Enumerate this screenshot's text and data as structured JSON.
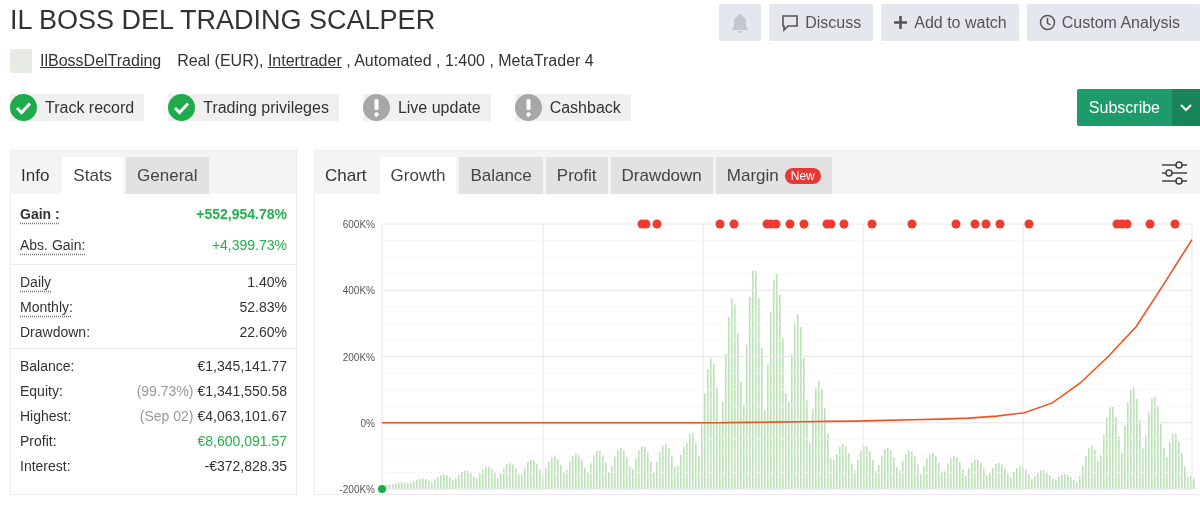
{
  "header": {
    "title": "IL BOSS DEL TRADING SCALPER",
    "actions": [
      {
        "kind": "bell",
        "disabled": true
      },
      {
        "kind": "discuss",
        "label": "Discuss",
        "disabled": false
      },
      {
        "kind": "add",
        "label": "Add to watch",
        "disabled": false
      },
      {
        "kind": "clock",
        "label": "Custom Analysis",
        "disabled": false
      }
    ]
  },
  "account": {
    "owner": "IlBossDelTrading",
    "type": "Real (EUR),",
    "broker": "Intertrader",
    "details": ", Automated , 1:400 , MetaTrader 4"
  },
  "badges": [
    {
      "label": "Track record",
      "verified": true
    },
    {
      "label": "Trading privileges",
      "verified": true
    },
    {
      "label": "Live update",
      "verified": false
    },
    {
      "label": "Cashback",
      "verified": false
    }
  ],
  "subscribe": {
    "label": "Subscribe"
  },
  "stats_panel": {
    "title": "Info",
    "tabs": [
      {
        "label": "Stats",
        "selected": true
      },
      {
        "label": "General",
        "selected": false
      }
    ],
    "groups": [
      [
        {
          "label": "Gain :",
          "value": "+552,954.78%",
          "bold": true,
          "dotted": true,
          "positive": true
        },
        {
          "label": "Abs. Gain:",
          "value": "+4,399.73%",
          "bold": false,
          "dotted": true,
          "positive": true
        }
      ],
      [
        {
          "label": "Daily",
          "value": "1.40%",
          "bold": false,
          "dotted": true,
          "positive": false
        },
        {
          "label": "Monthly:",
          "value": "52.83%",
          "bold": false,
          "dotted": true,
          "positive": false
        },
        {
          "label": "Drawdown:",
          "value": "22.60%",
          "bold": false,
          "dotted": false,
          "positive": false
        }
      ],
      [
        {
          "label": "Balance:",
          "value": "€1,345,141.77",
          "bold": false,
          "dotted": false,
          "positive": false
        },
        {
          "label": "Equity:",
          "note": "(99.73%)",
          "value": "€1,341,550.58",
          "bold": false,
          "dotted": false,
          "positive": false
        },
        {
          "label": "Highest:",
          "note": "(Sep 02)",
          "value": "€4,063,101.67",
          "bold": false,
          "dotted": false,
          "positive": false
        },
        {
          "label": "Profit:",
          "value": "€8,600,091.57",
          "bold": false,
          "dotted": false,
          "positive": true
        },
        {
          "label": "Interest:",
          "value": "-€372,828.35",
          "bold": false,
          "dotted": false,
          "positive": false
        }
      ]
    ]
  },
  "chart_panel": {
    "title": "Chart",
    "tabs": [
      {
        "label": "Growth",
        "selected": true
      },
      {
        "label": "Balance",
        "selected": false
      },
      {
        "label": "Profit",
        "selected": false
      },
      {
        "label": "Drawdown",
        "selected": false
      },
      {
        "label": "Margin",
        "selected": false,
        "badge": "New"
      }
    ],
    "chart_data": {
      "type": "line",
      "grid": true,
      "ylim": [
        -200000,
        600000
      ],
      "yticks": [
        {
          "value": -200000,
          "label": "-200K%"
        },
        {
          "value": 0,
          "label": "0%"
        },
        {
          "value": 200000,
          "label": "200K%"
        },
        {
          "value": 400000,
          "label": "400K%"
        },
        {
          "value": 600000,
          "label": "600K%"
        }
      ],
      "series": [
        {
          "color": "#f4511e",
          "values": [
            0,
            0,
            0,
            0,
            0,
            0,
            0,
            0,
            0,
            0,
            0,
            0,
            0,
            1000,
            2000,
            3000,
            4000,
            5000,
            7000,
            9000,
            11000,
            14000,
            20000,
            30000,
            60000,
            120000,
            200000,
            290000,
            420000,
            553000
          ]
        }
      ]
    }
  }
}
